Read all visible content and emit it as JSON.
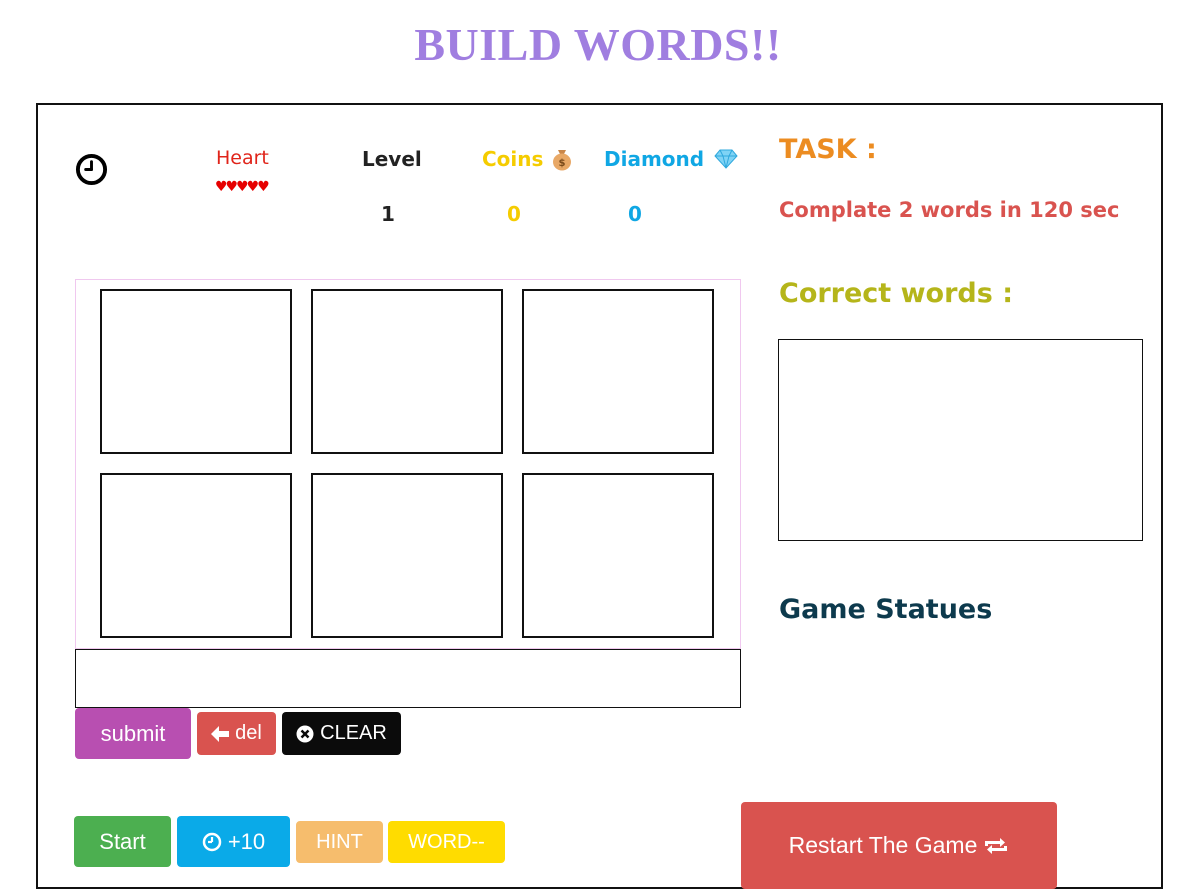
{
  "title": "BUILD WORDS!!",
  "stats": {
    "heart_label": "Heart",
    "hearts": "♥♥♥♥♥",
    "level_label": "Level",
    "level_value": "1",
    "coins_label": "Coins",
    "coins_icon": "money-bag-icon",
    "coins_value": "0",
    "diamond_label": "Diamond",
    "diamond_icon": "diamond-icon",
    "diamond_value": "0"
  },
  "letter_tiles": [
    "",
    "",
    "",
    "",
    "",
    ""
  ],
  "word_input_value": "",
  "actions": {
    "submit": "submit",
    "del": "del",
    "clear": "CLEAR"
  },
  "controls": {
    "start": "Start",
    "plus_time": "+10",
    "hint": "HINT",
    "word_minus": "WORD--",
    "restart": "Restart The Game"
  },
  "task": {
    "heading": "TASK :",
    "text": "Complate 2 words in 120 sec"
  },
  "correct_words": {
    "heading": "Correct words :",
    "items": []
  },
  "game_status": {
    "heading": "Game Statues"
  },
  "colors": {
    "title": "#a07ee0",
    "heart": "#e0241a",
    "coins": "#f5cc00",
    "diamond": "#10a7e4",
    "task_heading": "#ec8c21",
    "task_text": "#d9534f",
    "correct_heading": "#b5b51a",
    "status_heading": "#0d3a4d"
  }
}
